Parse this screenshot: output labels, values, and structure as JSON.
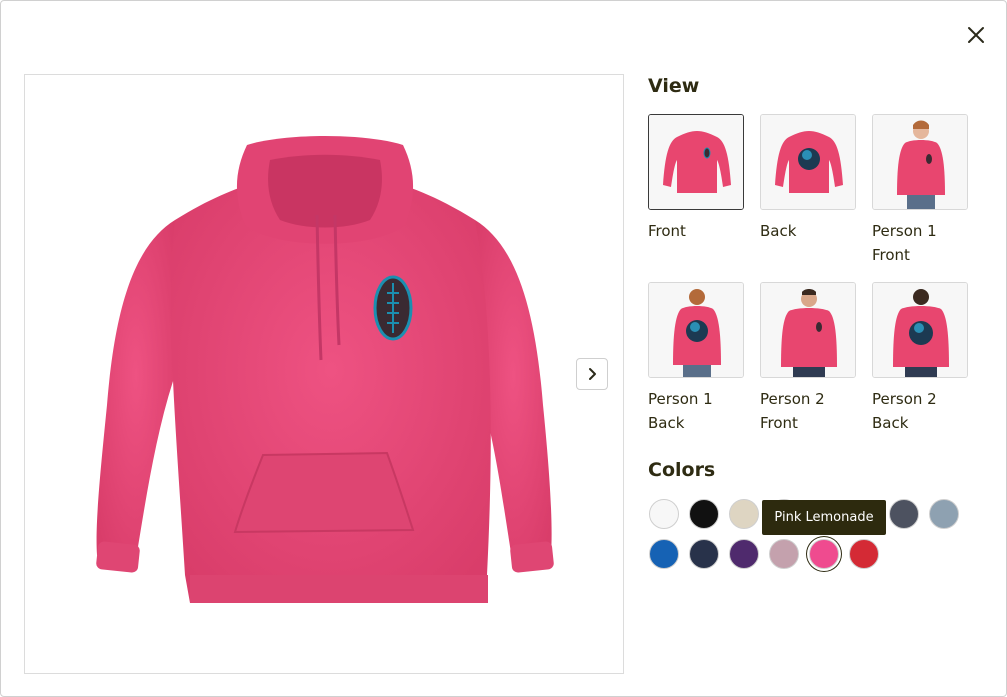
{
  "view": {
    "title": "View",
    "thumbnails": [
      {
        "label_line1": "Front",
        "label_line2": "",
        "variant": "front",
        "selected": true
      },
      {
        "label_line1": "Back",
        "label_line2": "",
        "variant": "back",
        "selected": false
      },
      {
        "label_line1": "Person 1",
        "label_line2": "Front",
        "variant": "person1-front",
        "selected": false
      },
      {
        "label_line1": "Person 1",
        "label_line2": "Back",
        "variant": "person1-back",
        "selected": false
      },
      {
        "label_line1": "Person 2",
        "label_line2": "Front",
        "variant": "person2-front",
        "selected": false
      },
      {
        "label_line1": "Person 2",
        "label_line2": "Back",
        "variant": "person2-back",
        "selected": false
      }
    ]
  },
  "colors": {
    "title": "Colors",
    "tooltip": "Pink Lemonade",
    "swatches": [
      {
        "name": "White",
        "hex": "#f7f7f7"
      },
      {
        "name": "Black",
        "hex": "#111111"
      },
      {
        "name": "Sand",
        "hex": "#ded5c2"
      },
      {
        "name": "Hidden",
        "hex": "#b9b9b9"
      },
      {
        "name": "Charcoal Heather",
        "hex": "#4d5260"
      },
      {
        "name": "Slate",
        "hex": "#8ea1b1"
      },
      {
        "name": "Royal",
        "hex": "#1662b4"
      },
      {
        "name": "Navy",
        "hex": "#28324a"
      },
      {
        "name": "Purple",
        "hex": "#4f2a6d"
      },
      {
        "name": "Orchid",
        "hex": "#c4a1ad"
      },
      {
        "name": "Pink Lemonade",
        "hex": "#ef4b8f",
        "selected": true
      },
      {
        "name": "Red",
        "hex": "#d42a35"
      }
    ]
  },
  "product": {
    "garment_color": "#ea4a77",
    "accent_color": "#1b8fb0"
  }
}
